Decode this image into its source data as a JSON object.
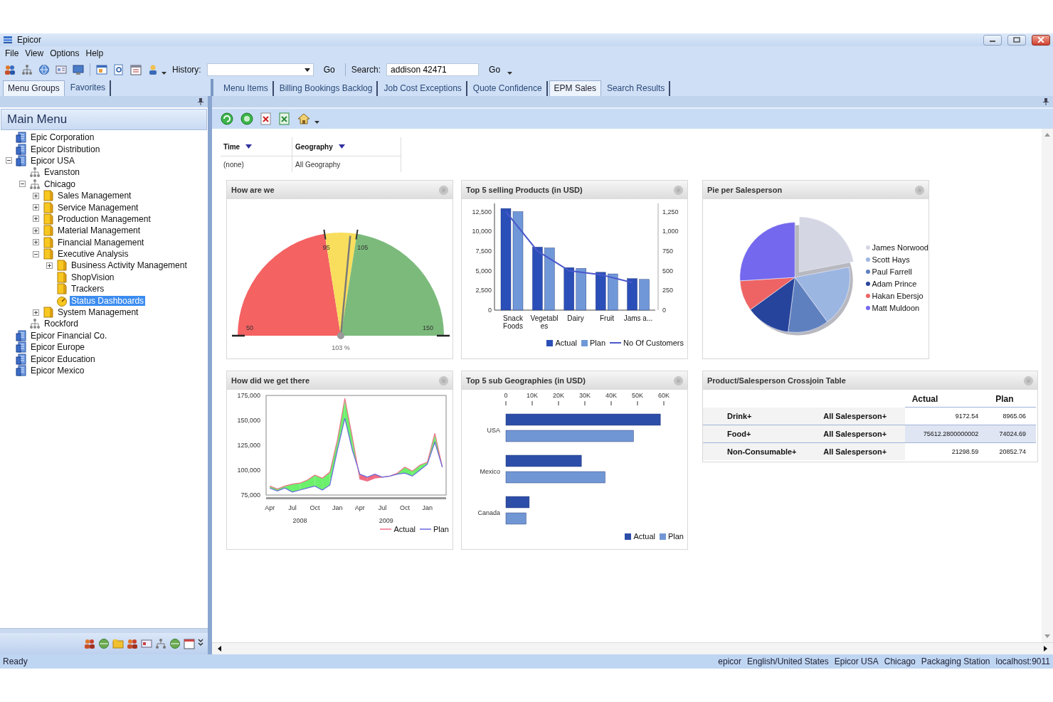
{
  "window": {
    "title": "Epicor"
  },
  "menu": [
    "File",
    "View",
    "Options",
    "Help"
  ],
  "toolbar": {
    "history_label": "History:",
    "history_go": "Go",
    "search_label": "Search:",
    "search_value": "addison 42471",
    "search_go": "Go"
  },
  "panel_tabs": [
    {
      "label": "Menu Groups",
      "selected": true
    },
    {
      "label": "Favorites",
      "selected": false
    }
  ],
  "document_tabs": [
    {
      "label": "Menu Items",
      "selected": false
    },
    {
      "label": "Billing Bookings Backlog",
      "selected": false
    },
    {
      "label": "Job Cost Exceptions",
      "selected": false
    },
    {
      "label": "Quote Confidence",
      "selected": false
    },
    {
      "label": "EPM Sales",
      "selected": true
    },
    {
      "label": "Search Results",
      "selected": false
    }
  ],
  "sidebar": {
    "title": "Main Menu",
    "tree": [
      {
        "label": "Epic Corporation",
        "kind": "company",
        "selected": false
      },
      {
        "label": "Epicor Distribution",
        "kind": "company",
        "selected": false
      },
      {
        "label": "Epicor USA",
        "kind": "company",
        "selected": false,
        "expanded": true,
        "children": [
          {
            "label": "Evanston",
            "kind": "site",
            "selected": false
          },
          {
            "label": "Chicago",
            "kind": "site",
            "selected": false,
            "expanded": true,
            "children": [
              {
                "label": "Sales Management",
                "kind": "folder",
                "selected": false,
                "expanded": false
              },
              {
                "label": "Service Management",
                "kind": "folder",
                "selected": false,
                "expanded": false
              },
              {
                "label": "Production Management",
                "kind": "folder",
                "selected": false,
                "expanded": false
              },
              {
                "label": "Material Management",
                "kind": "folder",
                "selected": false,
                "expanded": false
              },
              {
                "label": "Financial Management",
                "kind": "folder",
                "selected": false,
                "expanded": false
              },
              {
                "label": "Executive Analysis",
                "kind": "folder",
                "selected": false,
                "expanded": true,
                "children": [
                  {
                    "label": "Business Activity Management",
                    "kind": "folder",
                    "selected": false,
                    "expanded": false
                  },
                  {
                    "label": "ShopVision",
                    "kind": "folder",
                    "selected": false
                  },
                  {
                    "label": "Trackers",
                    "kind": "folder",
                    "selected": false
                  },
                  {
                    "label": "Status Dashboards",
                    "kind": "dashboard",
                    "selected": true
                  }
                ]
              },
              {
                "label": "System Management",
                "kind": "folder",
                "selected": false,
                "expanded": false
              }
            ]
          },
          {
            "label": "Rockford",
            "kind": "site",
            "selected": false
          }
        ]
      },
      {
        "label": "Epicor Financial Co.",
        "kind": "company",
        "selected": false
      },
      {
        "label": "Epicor Europe",
        "kind": "company",
        "selected": false
      },
      {
        "label": "Epicor Education",
        "kind": "company",
        "selected": false
      },
      {
        "label": "Epicor Mexico",
        "kind": "company",
        "selected": false
      }
    ]
  },
  "filters": [
    {
      "label": "Time",
      "value": "(none)"
    },
    {
      "label": "Geography",
      "value": "All Geography"
    }
  ],
  "panels": [
    {
      "kind": "gauge",
      "title": "How are we",
      "min": "50",
      "low": "95",
      "high": "105",
      "max": "150",
      "reading": "103 %",
      "level": 0.53
    },
    {
      "kind": "bar",
      "title": "Top 5 selling Products (in USD)",
      "chart_data": {
        "type": "bar",
        "stacked": false,
        "legend": "lower right",
        "categories": [
          "Snack Foods",
          "Vegetables",
          "Dairy",
          "Fruit",
          "Jams a..."
        ],
        "series": [
          {
            "name": "Actual",
            "color": "#2b4fb8",
            "values": [
              12900,
              8000,
              5400,
              4800,
              4000
            ]
          },
          {
            "name": "Plan",
            "color": "#7098d8",
            "values": [
              12500,
              7900,
              5300,
              4600,
              3900
            ]
          },
          {
            "name": "No Of Customers",
            "color": "#4a58cc",
            "type": "line",
            "axis": "y2",
            "values": [
              1250,
              750,
              500,
              450,
              350
            ]
          }
        ],
        "ylim": [
          0,
          13000
        ],
        "yticks": [
          {
            "value": 0,
            "label": "0"
          },
          {
            "value": 2500,
            "label": "2,500"
          },
          {
            "value": 5000,
            "label": "5,000"
          },
          {
            "value": 7500,
            "label": "7,500"
          },
          {
            "value": 10000,
            "label": "10,000"
          },
          {
            "value": 12500,
            "label": "12,500"
          }
        ],
        "y2lim": [
          0,
          1300
        ],
        "y2ticks": [
          {
            "value": 0,
            "label": "0"
          },
          {
            "value": 250,
            "label": "250"
          },
          {
            "value": 500,
            "label": "500"
          },
          {
            "value": 750,
            "label": "750"
          },
          {
            "value": 1000,
            "label": "1,000"
          },
          {
            "value": 1250,
            "label": "1,250"
          }
        ]
      }
    },
    {
      "kind": "pie",
      "title": "Pie per Salesperson",
      "legend": [
        {
          "name": "James Norwood",
          "color": "#d4d6e4"
        },
        {
          "name": "Scott Hays",
          "color": "#9cb6e2"
        },
        {
          "name": "Paul Farrell",
          "color": "#5f80bf"
        },
        {
          "name": "Adam Prince",
          "color": "#27449c"
        },
        {
          "name": "Hakan Ebersjo",
          "color": "#ee6464"
        },
        {
          "name": "Matt Muldoon",
          "color": "#7468ee"
        }
      ]
    },
    {
      "kind": "line",
      "title": "How did we get there",
      "year_labels": [
        "2008",
        "2009"
      ],
      "chart_data": {
        "type": "line",
        "legend": "lower right",
        "categories": [
          "Apr",
          null,
          null,
          "Jul",
          null,
          null,
          "Oct",
          null,
          null,
          "Jan",
          null,
          null,
          "Apr",
          null,
          null,
          "Jul",
          null,
          null,
          "Oct",
          null,
          null,
          "Jan",
          null,
          null
        ],
        "series": [
          {
            "name": "Actual",
            "color": "#f0708a",
            "values": [
              84000,
              81000,
              84000,
              86000,
              87000,
              90000,
              95000,
              92000,
              98000,
              130000,
              172000,
              133000,
              91000,
              89000,
              92000,
              93000,
              94000,
              97000,
              103000,
              99000,
              105000,
              108000,
              137000,
              103000
            ]
          },
          {
            "name": "Plan",
            "color": "#6868e0",
            "values": [
              82000,
              79000,
              82000,
              78000,
              80000,
              82000,
              84000,
              80000,
              85000,
              120000,
              152000,
              120000,
              96000,
              93000,
              96000,
              93000,
              94000,
              96000,
              97000,
              94000,
              100000,
              106000,
              128000,
              103000
            ]
          }
        ],
        "ylim": [
          75000,
          175000
        ],
        "yticks": [
          {
            "value": 75000,
            "label": "75,000"
          },
          {
            "value": 100000,
            "label": "100,000"
          },
          {
            "value": 125000,
            "label": "125,000"
          },
          {
            "value": 150000,
            "label": "150,000"
          },
          {
            "value": 175000,
            "label": "175,000"
          }
        ]
      }
    },
    {
      "kind": "hbar",
      "title": "Top 5 sub Geographies (in USD)",
      "chart_data": {
        "type": "bar",
        "orientation": "horizontal",
        "legend": "lower right",
        "categories": [
          "USA",
          "Mexico",
          "Canada"
        ],
        "series": [
          {
            "name": "Actual",
            "color": "#2d4ea8",
            "values": [
              58700,
              28700,
              8900
            ]
          },
          {
            "name": "Plan",
            "color": "#7196d4",
            "values": [
              48500,
              37700,
              7700
            ]
          }
        ],
        "xlim": [
          0,
          60000
        ],
        "xticks": [
          {
            "value": 0,
            "label": "0"
          },
          {
            "value": 10000,
            "label": "10K"
          },
          {
            "value": 20000,
            "label": "20K"
          },
          {
            "value": 30000,
            "label": "30K"
          },
          {
            "value": 40000,
            "label": "40K"
          },
          {
            "value": 50000,
            "label": "50K"
          },
          {
            "value": 60000,
            "label": "60K"
          }
        ]
      }
    },
    {
      "kind": "table",
      "title": "Product/Salesperson Crossjoin Table",
      "columns": [
        "Actual",
        "Plan"
      ],
      "rows": [
        {
          "product": "Drink+",
          "salesperson": "All Salesperson+",
          "actual": "9172.54",
          "plan": "8965.06",
          "selected": false
        },
        {
          "product": "Food+",
          "salesperson": "All Salesperson+",
          "actual": "75612.2800000002",
          "plan": "74024.69",
          "selected": true
        },
        {
          "product": "Non-Consumable+",
          "salesperson": "All Salesperson+",
          "actual": "21298.59",
          "plan": "20852.74",
          "selected": false
        }
      ]
    }
  ],
  "status_bar": {
    "text": "Ready",
    "fields": [
      "epicor",
      "English/United States",
      "Epicor USA",
      "Chicago",
      "Packaging Station",
      "localhost:9011"
    ]
  }
}
